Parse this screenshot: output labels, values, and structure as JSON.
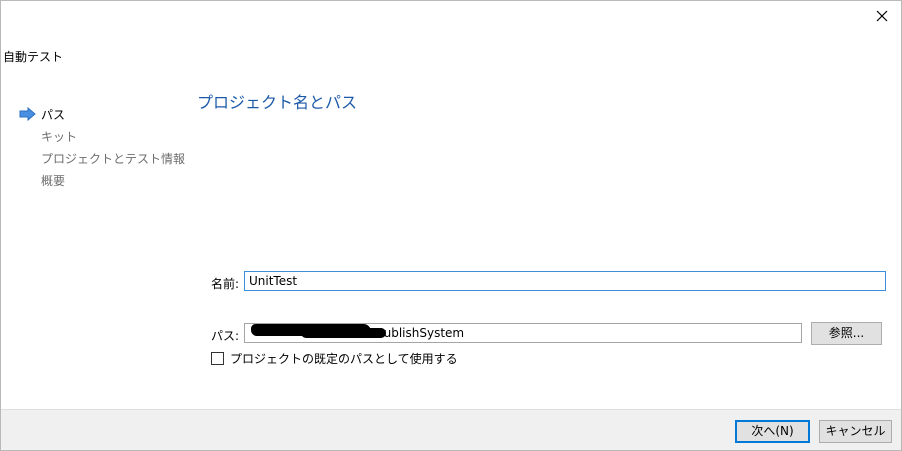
{
  "window": {
    "close_glyph": "✕"
  },
  "wizard": {
    "title": "自動テスト",
    "steps": [
      {
        "label": "パス",
        "state": "current"
      },
      {
        "label": "キット",
        "state": "pending"
      },
      {
        "label": "プロジェクトとテスト情報",
        "state": "pending"
      },
      {
        "label": "概要",
        "state": "pending"
      }
    ],
    "current_step_icon": "arrow-right-icon"
  },
  "page": {
    "title": "プロジェクト名とパス"
  },
  "form": {
    "name_label": "名前:",
    "name_value": "UnitTest",
    "path_label": "パス:",
    "path_value_visible": "IotPublishSystem",
    "browse_label": "参照...",
    "default_path_checkbox_label": "プロジェクトの既定のパスとして使用する",
    "default_path_checked": false
  },
  "footer": {
    "next_label": "次へ(N)",
    "cancel_label": "キャンセル"
  },
  "colors": {
    "title_blue": "#1c5aa8",
    "focus_border": "#3c8fd8",
    "arrow_blue": "#4a90e2"
  }
}
